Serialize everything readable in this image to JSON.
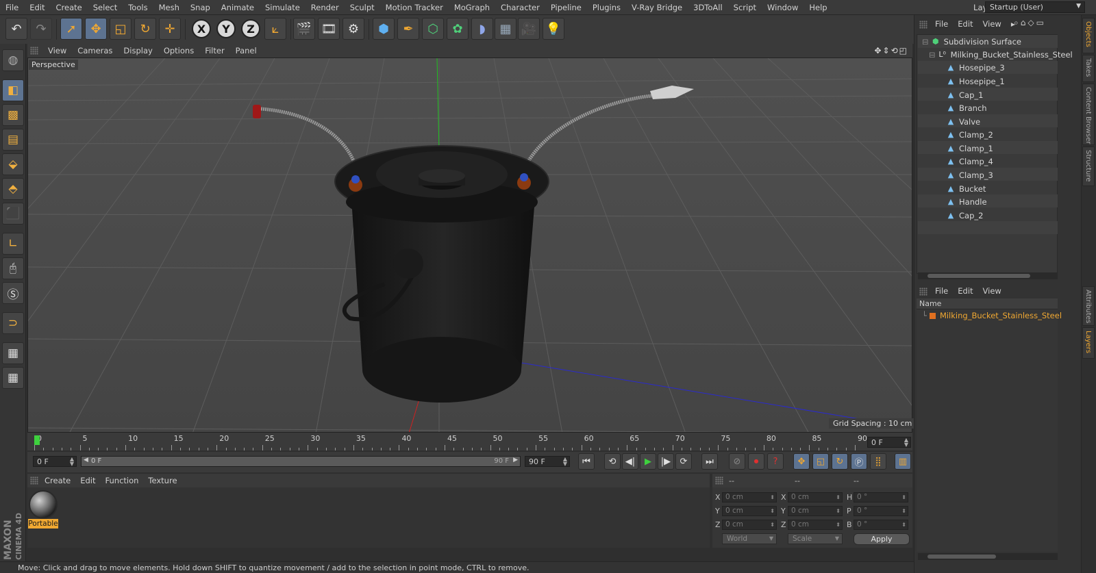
{
  "menubar": [
    "File",
    "Edit",
    "Create",
    "Select",
    "Tools",
    "Mesh",
    "Snap",
    "Animate",
    "Simulate",
    "Render",
    "Sculpt",
    "Motion Tracker",
    "MoGraph",
    "Character",
    "Pipeline",
    "Plugins",
    "V-Ray Bridge",
    "3DToAll",
    "Script",
    "Window",
    "Help"
  ],
  "layout": {
    "label": "Layout:",
    "value": "Startup (User)"
  },
  "toolbar": {
    "axis_x": "X",
    "axis_y": "Y",
    "axis_z": "Z"
  },
  "viewport": {
    "menu": [
      "View",
      "Cameras",
      "Display",
      "Options",
      "Filter",
      "Panel"
    ],
    "label": "Perspective",
    "grid_spacing": "Grid Spacing : 10 cm"
  },
  "timeline": {
    "ticks": [
      "0",
      "5",
      "10",
      "15",
      "20",
      "25",
      "30",
      "35",
      "40",
      "45",
      "50",
      "55",
      "60",
      "65",
      "70",
      "75",
      "80",
      "85",
      "90"
    ],
    "current_frame": "0 F",
    "start_frame": "0 F",
    "slider_start": "0 F",
    "slider_end": "90 F",
    "end_frame": "90 F"
  },
  "material_manager": {
    "menu": [
      "Create",
      "Edit",
      "Function",
      "Texture"
    ],
    "materials": [
      {
        "name": "Portable"
      }
    ]
  },
  "coordinates": {
    "headers": [
      "--",
      "--",
      "--"
    ],
    "rows": [
      {
        "l1": "X",
        "v1": "0 cm",
        "l2": "X",
        "v2": "0 cm",
        "l3": "H",
        "v3": "0 °"
      },
      {
        "l1": "Y",
        "v1": "0 cm",
        "l2": "Y",
        "v2": "0 cm",
        "l3": "P",
        "v3": "0 °"
      },
      {
        "l1": "Z",
        "v1": "0 cm",
        "l2": "Z",
        "v2": "0 cm",
        "l3": "B",
        "v3": "0 °"
      }
    ],
    "mode": "World",
    "type": "Scale",
    "apply": "Apply"
  },
  "status": "Move: Click and drag to move elements. Hold down SHIFT to quantize movement / add to the selection in point mode, CTRL to remove.",
  "object_manager": {
    "menu": [
      "File",
      "Edit",
      "View"
    ],
    "root": "Subdivision Surface",
    "group": "Milking_Bucket_Stainless_Steel",
    "children": [
      "Hosepipe_3",
      "Hosepipe_1",
      "Cap_1",
      "Branch",
      "Valve",
      "Clamp_2",
      "Clamp_1",
      "Clamp_4",
      "Clamp_3",
      "Bucket",
      "Handle",
      "Cap_2"
    ]
  },
  "layers": {
    "menu": [
      "File",
      "Edit",
      "View"
    ],
    "column": "Name",
    "items": [
      "Milking_Bucket_Stainless_Steel"
    ]
  },
  "side_tabs": [
    "Objects",
    "Takes",
    "Content Browser",
    "Structure",
    "Attributes",
    "Layers"
  ],
  "brand": {
    "maxon": "MAXON",
    "cinema": "CINEMA 4D"
  }
}
